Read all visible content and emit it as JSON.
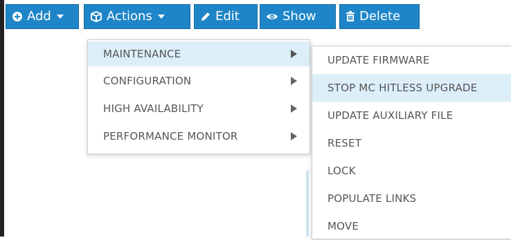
{
  "toolbar": {
    "add_label": "Add",
    "actions_label": "Actions",
    "edit_label": "Edit",
    "show_label": "Show",
    "delete_label": "Delete",
    "accent": "#1e86c8"
  },
  "menu": {
    "items": [
      {
        "label": "MAINTENANCE"
      },
      {
        "label": "CONFIGURATION"
      },
      {
        "label": "HIGH AVAILABILITY"
      },
      {
        "label": "PERFORMANCE MONITOR"
      }
    ],
    "active_index": 0
  },
  "submenu": {
    "items": [
      {
        "label": "UPDATE FIRMWARE"
      },
      {
        "label": "STOP MC HITLESS UPGRADE"
      },
      {
        "label": "UPDATE AUXILIARY FILE"
      },
      {
        "label": "RESET"
      },
      {
        "label": "LOCK"
      },
      {
        "label": "POPULATE LINKS"
      },
      {
        "label": "MOVE"
      }
    ],
    "active_index": 1
  }
}
